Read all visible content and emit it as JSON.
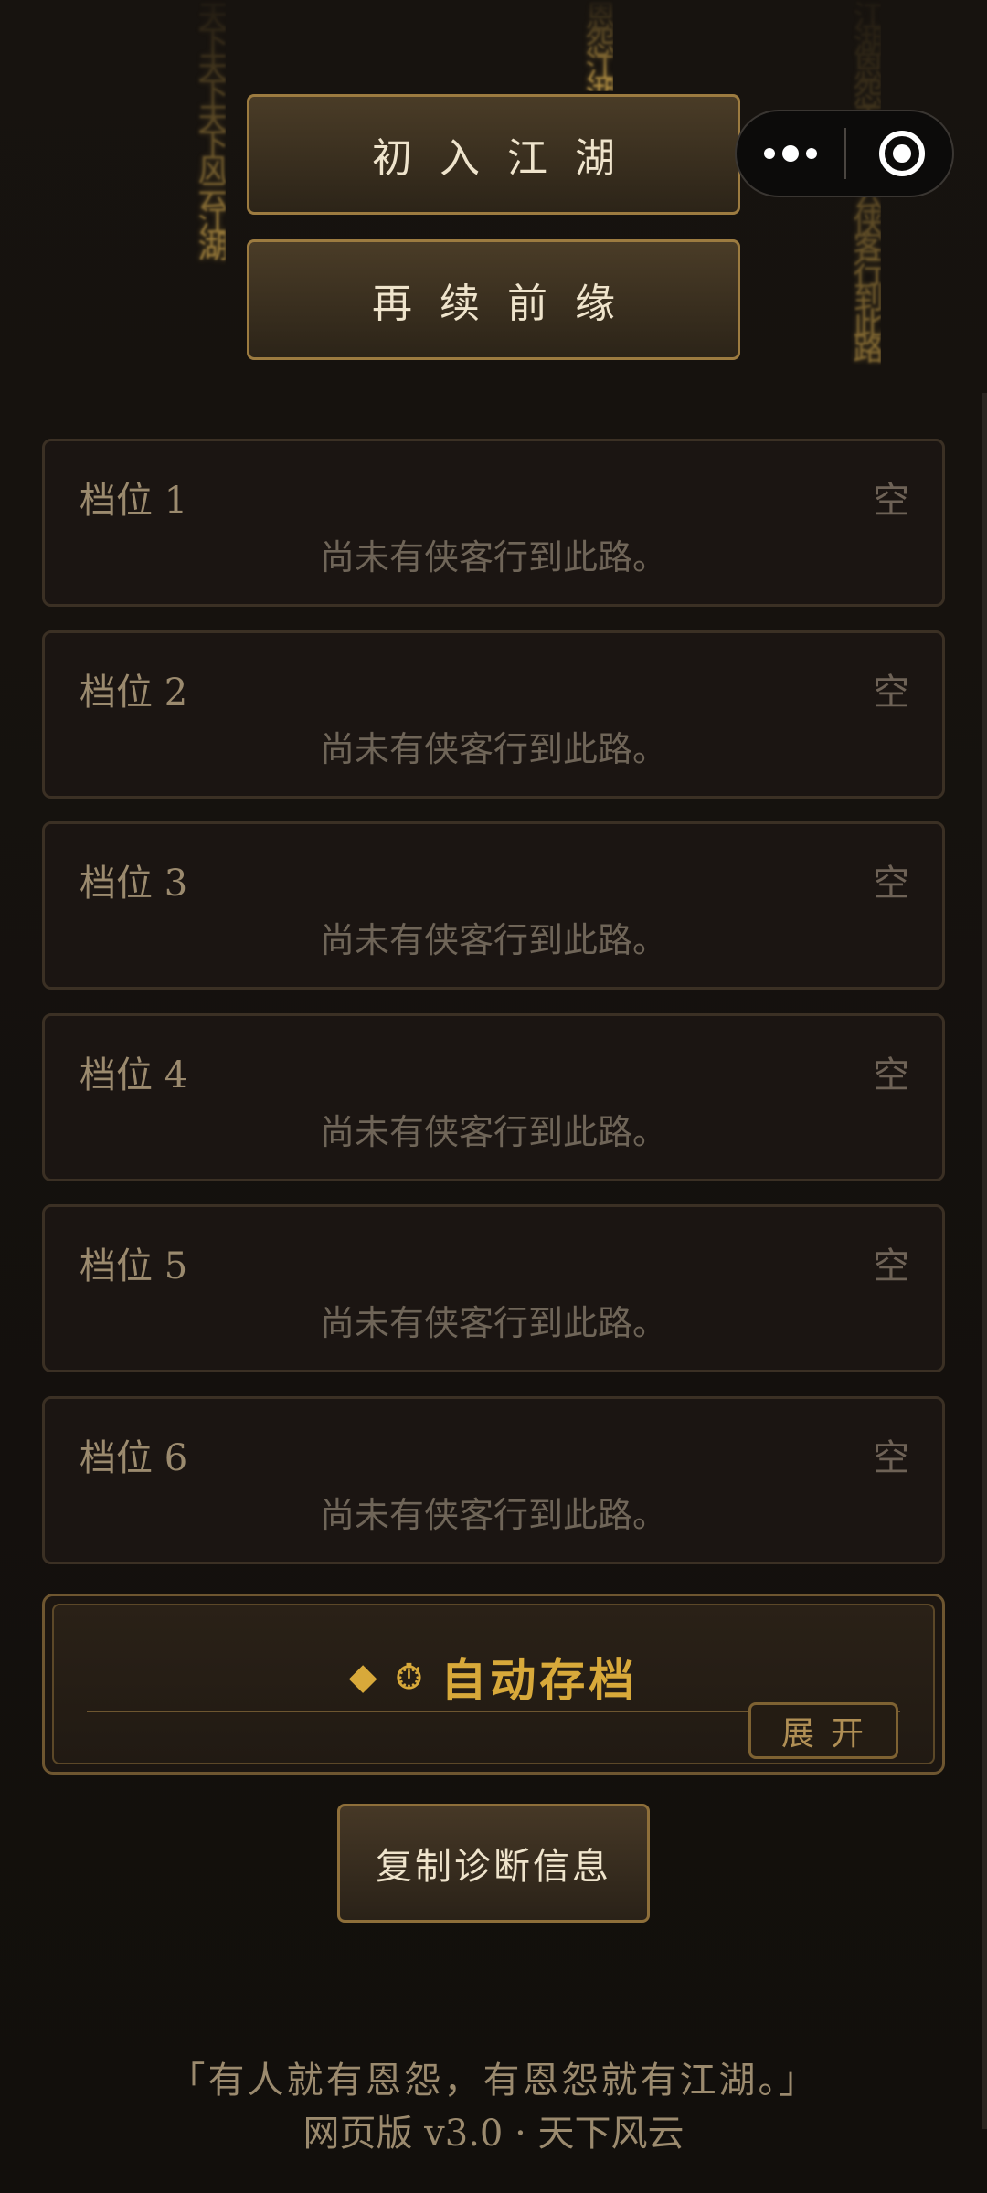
{
  "decor": {
    "rain_1": "天下天下天下风云江湖",
    "rain_2": "恩怨江湖",
    "rain_3": "江湖恩怨天下风云侠客行到此路"
  },
  "menu": {
    "new_game_label": "初入江湖",
    "continue_label": "再续前缘"
  },
  "capsule": {
    "more_icon": "more-dots-icon",
    "close_icon": "target-circle-icon"
  },
  "save_slots": [
    {
      "name": "档位 1",
      "status": "空",
      "description": "尚未有侠客行到此路。"
    },
    {
      "name": "档位 2",
      "status": "空",
      "description": "尚未有侠客行到此路。"
    },
    {
      "name": "档位 3",
      "status": "空",
      "description": "尚未有侠客行到此路。"
    },
    {
      "name": "档位 4",
      "status": "空",
      "description": "尚未有侠客行到此路。"
    },
    {
      "name": "档位 5",
      "status": "空",
      "description": "尚未有侠客行到此路。"
    },
    {
      "name": "档位 6",
      "status": "空",
      "description": "尚未有侠客行到此路。"
    }
  ],
  "auto_save": {
    "diamond_glyph": "◆",
    "clock_glyph": "⏱",
    "title": "自动存档",
    "expand_label": "展开"
  },
  "diagnostics": {
    "copy_label": "复制诊断信息"
  },
  "footer": {
    "quote": "「有人就有恩怨，有恩怨就有江湖。」",
    "version": "网页版 v3.0 · 天下风云"
  },
  "colors": {
    "accent_gold": "#d8a93a",
    "background": "#15120f",
    "border": "#9c7b40"
  }
}
